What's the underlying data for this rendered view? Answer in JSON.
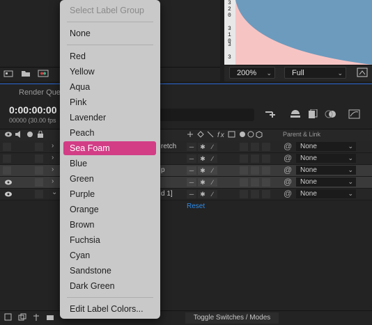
{
  "menu": {
    "header": "Select Label Group",
    "items": [
      "None",
      "Red",
      "Yellow",
      "Aqua",
      "Pink",
      "Lavender",
      "Peach",
      "Sea Foam",
      "Blue",
      "Green",
      "Purple",
      "Orange",
      "Brown",
      "Fuchsia",
      "Cyan",
      "Sandstone",
      "Dark Green"
    ],
    "selected": "Sea Foam",
    "footer": "Edit Label Colors..."
  },
  "viewer": {
    "zoom": "200%",
    "resolution": "Full",
    "ruler_numbers": [
      "3",
      "2",
      "0",
      "3",
      "1",
      "0",
      "3",
      "2",
      "0",
      "3"
    ]
  },
  "timeline": {
    "render_queue_tab": "Render Que",
    "timecode": "0:00:00:00",
    "frame_info": "00000 (30.00 fps",
    "parent_link_header": "Parent & Link",
    "layer_names": [
      "retch",
      "",
      "p",
      "",
      "d 1]"
    ],
    "parent_values": [
      "None",
      "None",
      "None",
      "None",
      "None"
    ],
    "reset": "Reset",
    "toggle": "Toggle Switches / Modes"
  },
  "colors": {
    "highlight": "#d23d86",
    "viewer_pink": "#f7c4c4",
    "viewer_blue": "#6c9bbd",
    "accent_blue": "#2d8ceb"
  }
}
